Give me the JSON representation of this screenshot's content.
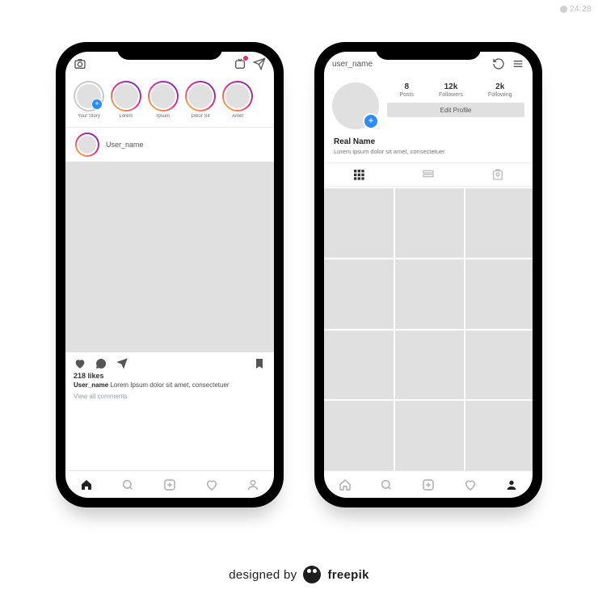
{
  "watermark": "24:28",
  "credit": {
    "prefix": "designed by",
    "brand": "freepik"
  },
  "feed": {
    "stories": [
      {
        "label": "Your Story",
        "self": true
      },
      {
        "label": "Lorem"
      },
      {
        "label": "Ipsum"
      },
      {
        "label": "Dolor Sit"
      },
      {
        "label": "Amet"
      }
    ],
    "post": {
      "username": "User_name",
      "likes": "218 likes",
      "caption_user": "User_name",
      "caption_text": "Lorem Ipsum dolor sit amet, consectetuer",
      "view_comments": "View all comments"
    }
  },
  "profile": {
    "username": "user_name",
    "stats": [
      {
        "n": "8",
        "l": "Posts"
      },
      {
        "n": "12k",
        "l": "Followers"
      },
      {
        "n": "2k",
        "l": "Following"
      }
    ],
    "edit_label": "Edit Profile",
    "real_name": "Real Name",
    "bio": "Lorem ipsum dolor sit amet, consectetuer",
    "grid_cells": 12
  }
}
